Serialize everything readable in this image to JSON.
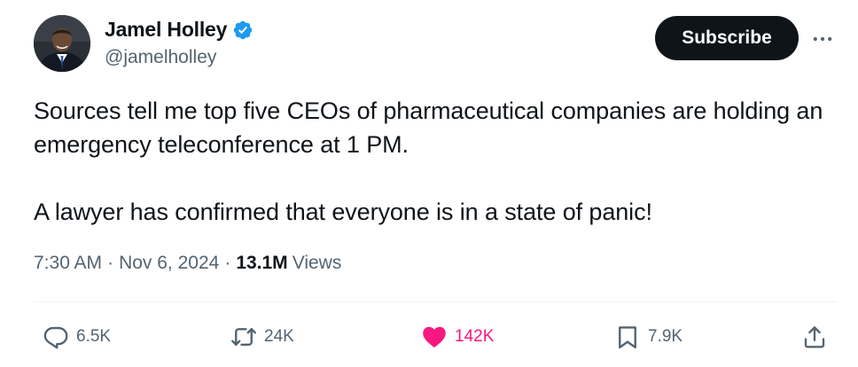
{
  "author": {
    "name": "Jamel Holley",
    "handle": "@jamelholley",
    "verified_color": "#1d9bf0"
  },
  "header": {
    "subscribe_label": "Subscribe",
    "more_icon": "more-horizontal-icon"
  },
  "tweet": {
    "paragraphs": [
      "Sources tell me top five CEOs of pharmaceutical companies are holding an emergency teleconference at 1 PM.",
      "A lawyer has confirmed that everyone is in a state of panic!"
    ],
    "time": "7:30 AM",
    "date": "Nov 6, 2024",
    "separator": "·",
    "views_count": "13.1M",
    "views_label": "Views"
  },
  "actions": {
    "replies": {
      "icon": "reply-icon",
      "count": "6.5K"
    },
    "reposts": {
      "icon": "repost-icon",
      "count": "24K"
    },
    "likes": {
      "icon": "heart-icon",
      "count": "142K",
      "liked": true,
      "color": "#f91880"
    },
    "bookmarks": {
      "icon": "bookmark-icon",
      "count": "7.9K"
    },
    "share": {
      "icon": "share-icon"
    }
  },
  "colors": {
    "text_primary": "#0f1419",
    "text_secondary": "#536471",
    "like_active": "#f91880",
    "button_bg": "#0f1419"
  }
}
